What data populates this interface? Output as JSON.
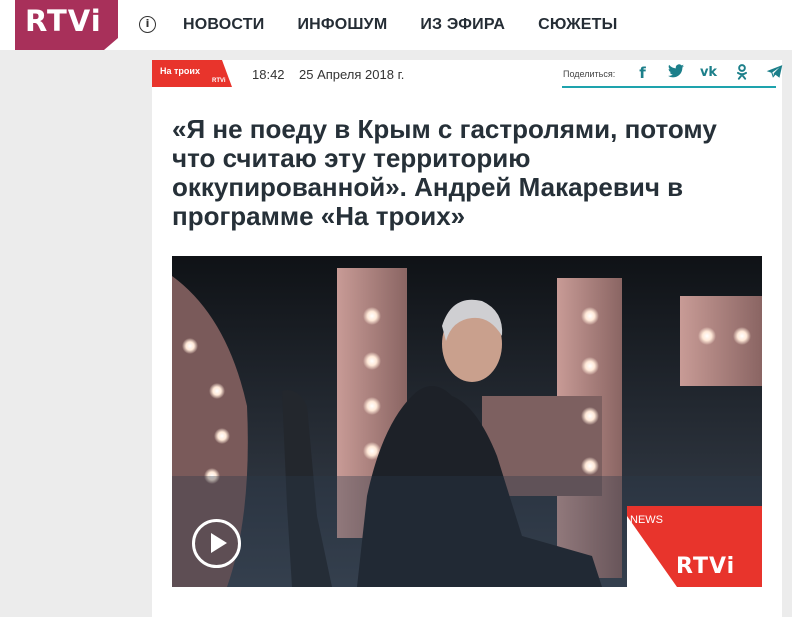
{
  "header": {
    "logo": "RTVi",
    "info_icon": "info-icon",
    "nav": [
      "НОВОСТИ",
      "ИНФОШУМ",
      "ИЗ ЭФИРА",
      "СЮЖЕТЫ"
    ]
  },
  "article": {
    "tag": "На троих",
    "tag_small": "RTVi",
    "time": "18:42",
    "date": "25 Апреля 2018 г.",
    "share_label": "Поделиться:",
    "share_icons": [
      "facebook-icon",
      "twitter-icon",
      "vk-icon",
      "odnoklassniki-icon",
      "telegram-icon"
    ],
    "headline": "«Я не поеду в Крым с гастролями, потому что считаю эту территорию оккупированной». Андрей Макаревич в программе «На троих»"
  },
  "video": {
    "badge_news": "NEWS",
    "badge_logo": "RTVi"
  },
  "colors": {
    "brand": "#a8305a",
    "tag_red": "#e8342c",
    "share_teal": "#1c7f8a"
  }
}
